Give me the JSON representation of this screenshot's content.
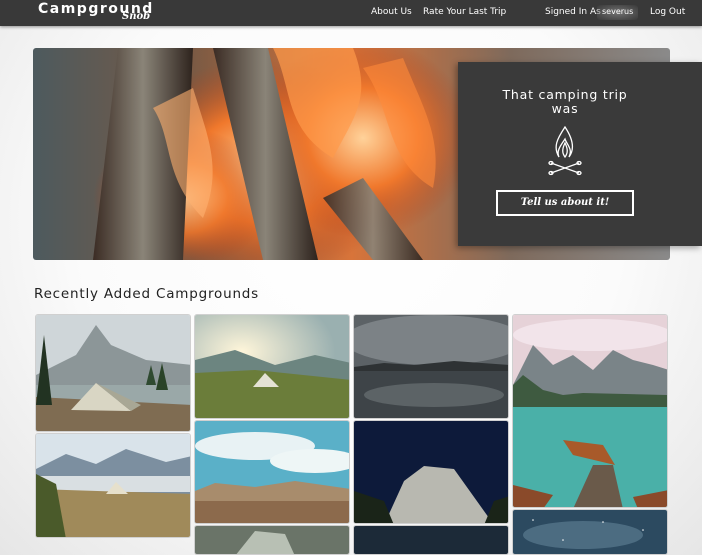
{
  "navbar": {
    "brand_main": "Campground",
    "brand_script": "Snob",
    "links": {
      "about": "About Us",
      "rate": "Rate Your Last Trip",
      "signed_in_label": "Signed In As",
      "username": "severus",
      "logout": "Log Out"
    }
  },
  "hero": {
    "cta_text": "That camping trip was",
    "cta_button": "Tell us about it!",
    "icon": "campfire-icon"
  },
  "recent": {
    "title": "Recently Added Campgrounds",
    "images": [
      "tent-mountain-lake-photo",
      "tent-sunrise-meadow-photo",
      "cloudy-lake-reflection-photo",
      "mountain-lake-boat-dock-photo",
      "tent-hills-fog-photo",
      "badlands-clouds-photo",
      "el-capitan-night-photo",
      "starry-sky-photo",
      "rocks-closeup-photo",
      "forest-night-photo"
    ]
  },
  "colors": {
    "navbar": "#393939",
    "cta_panel": "#3a3a3a",
    "text_dark": "#222222"
  }
}
